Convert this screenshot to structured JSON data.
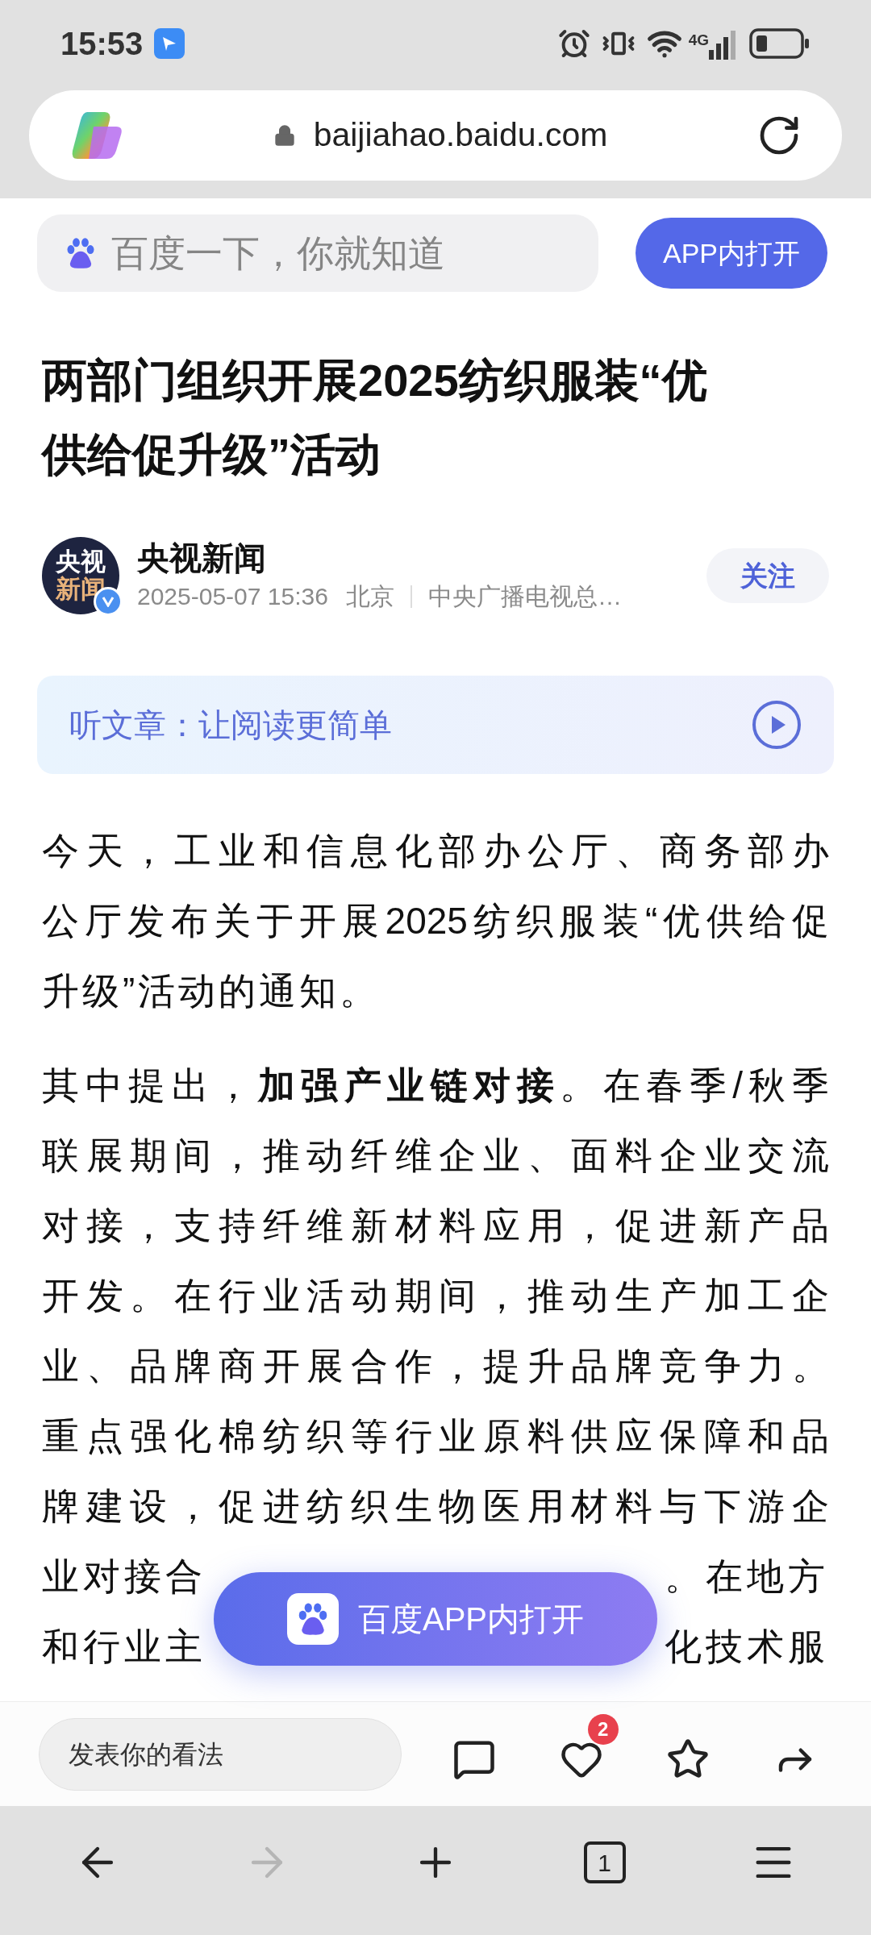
{
  "status_bar": {
    "time": "15:53",
    "network": "4G"
  },
  "address_bar": {
    "url": "baijiahao.baidu.com"
  },
  "site_header": {
    "search_placeholder": "百度一下，你就知道",
    "open_app_button": "APP内打开"
  },
  "article": {
    "title": "两部门组织开展2025纺织服装“优供给促升级”活动",
    "author": {
      "name": "央视新闻",
      "avatar_lines": [
        "央视",
        "新闻"
      ],
      "verified": true,
      "date": "2025-05-07 15:36",
      "location": "北京",
      "source": "中央广播电视总…",
      "follow_button": "关注"
    },
    "listen_bar": {
      "label": "听文章：让阅读更简单"
    },
    "paragraphs": [
      {
        "lines": [
          [
            "今天，工业和信息化部办公厅、商务部办"
          ],
          [
            "公厅发布关于开展2025纺织服装“优供给促"
          ],
          [
            "升级”活动的通知。"
          ]
        ]
      },
      {
        "lines": [
          [
            "其中提出，**加强产业链对接**。在春季/秋季"
          ],
          [
            "联展期间，推动纤维企业、面料企业交流"
          ],
          [
            "对接，支持纤维新材料应用，促进新产品"
          ],
          [
            "开发。在行业活动期间，推动生产加工企"
          ],
          [
            "业、品牌商开展合作，提升品牌竞争力。"
          ],
          [
            "重点强化棉纺织等行业原料供应保障和品"
          ],
          [
            "牌建设，促进纺织生物医用材料与下游企"
          ],
          [
            "业对接合",
            "。在地方"
          ],
          [
            "和行业主",
            "化技术服"
          ]
        ]
      }
    ]
  },
  "floating_button": {
    "label": "百度APP内打开"
  },
  "comment_bar": {
    "placeholder": "发表你的看法",
    "actions": [
      {
        "kind": "comment"
      },
      {
        "kind": "like",
        "badge": "2"
      },
      {
        "kind": "favorite"
      },
      {
        "kind": "share"
      }
    ]
  },
  "nav_bar": [
    {
      "kind": "back",
      "disabled": false
    },
    {
      "kind": "forward",
      "disabled": true
    },
    {
      "kind": "new_tab",
      "disabled": false
    },
    {
      "kind": "tabs",
      "count": "1",
      "disabled": false
    },
    {
      "kind": "menu",
      "disabled": false
    }
  ]
}
